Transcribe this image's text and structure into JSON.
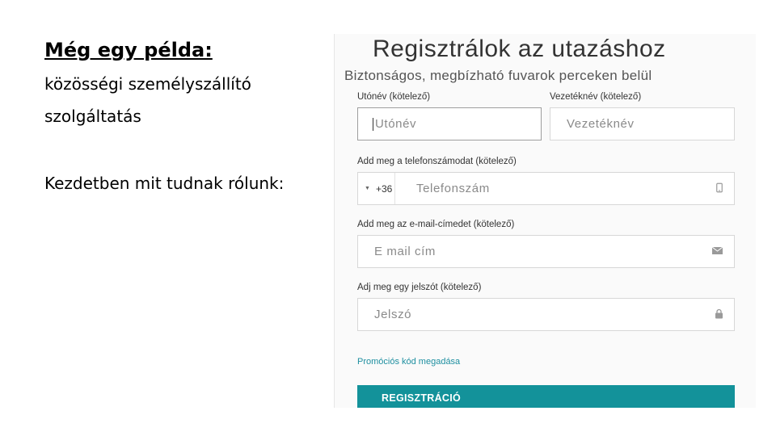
{
  "slide": {
    "heading": "Még egy példa:",
    "line1": "közösségi személyszállító",
    "line2": "szolgáltatás",
    "line3": "Kezdetben mit tudnak rólunk:"
  },
  "form": {
    "title": "Regisztrálok az utazáshoz",
    "subtitle": "Biztonságos, megbízható fuvarok perceken belül",
    "first_name": {
      "label": "Utónév (kötelező)",
      "placeholder": "Utónév"
    },
    "last_name": {
      "label": "Vezetéknév (kötelező)",
      "placeholder": "Vezetéknév"
    },
    "phone": {
      "label": "Add meg a telefonszámodat (kötelező)",
      "prefix": "+36",
      "placeholder": "Telefonszám",
      "icon": "phone-icon"
    },
    "email": {
      "label": "Add meg az e-mail-címedet (kötelező)",
      "placeholder": "E mail cím",
      "icon": "envelope-icon"
    },
    "password": {
      "label": "Adj meg egy jelszót (kötelező)",
      "placeholder": "Jelszó",
      "icon": "lock-icon"
    },
    "promo_link": "Promóciós kód megadása",
    "submit_label": "REGISZTRÁCIÓ",
    "colors": {
      "accent": "#13929a",
      "link": "#1e8fa0"
    }
  }
}
